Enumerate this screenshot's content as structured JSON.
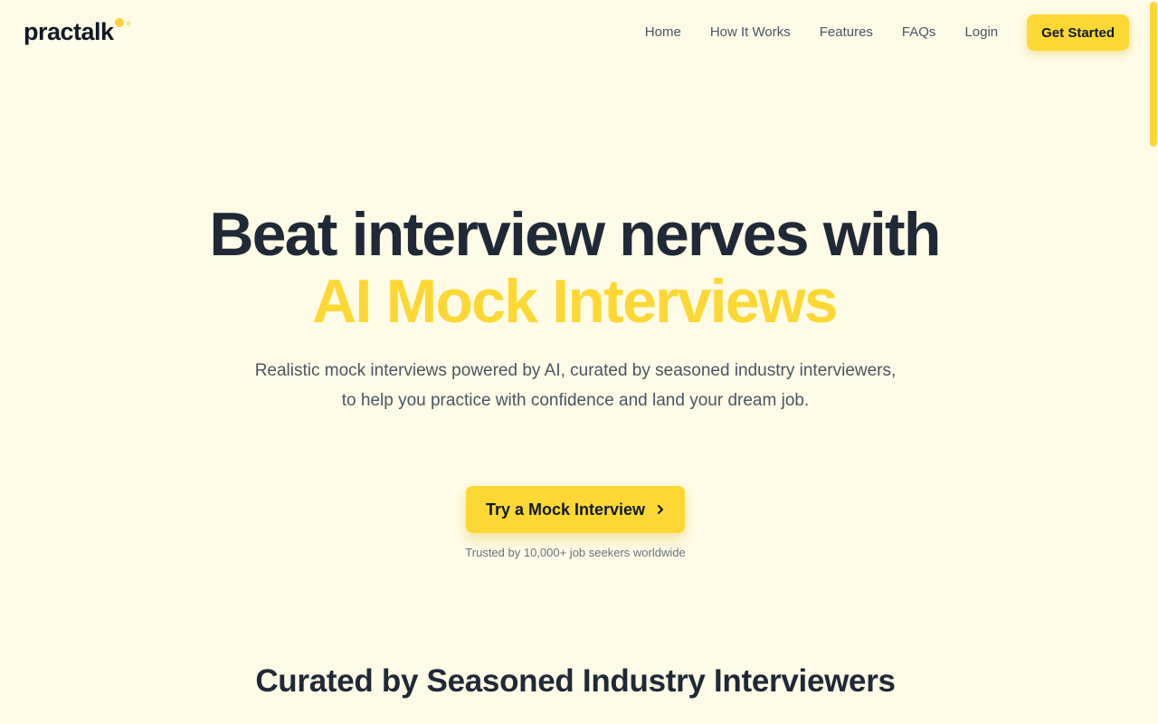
{
  "brand": {
    "name": "practalk",
    "accent_color": "#fdd835"
  },
  "nav": {
    "items": [
      {
        "label": "Home"
      },
      {
        "label": "How It Works"
      },
      {
        "label": "Features"
      },
      {
        "label": "FAQs"
      },
      {
        "label": "Login"
      }
    ],
    "cta_label": "Get Started"
  },
  "hero": {
    "title_line1": "Beat interview nerves with",
    "title_line2": "AI Mock Interviews",
    "subtitle_line1": "Realistic mock interviews powered by AI, curated by seasoned industry interviewers,",
    "subtitle_line2": "to help you practice with confidence and land your dream job.",
    "cta_label": "Try a Mock Interview",
    "cta_icon": "chevron-right-icon",
    "trust_text": "Trusted by 10,000+ job seekers worldwide"
  },
  "section": {
    "title": "Curated by Seasoned Industry Interviewers"
  },
  "colors": {
    "background": "#fefbe6",
    "heading": "#1f2937",
    "body_text": "#4b5563",
    "muted_text": "#6b7280"
  }
}
